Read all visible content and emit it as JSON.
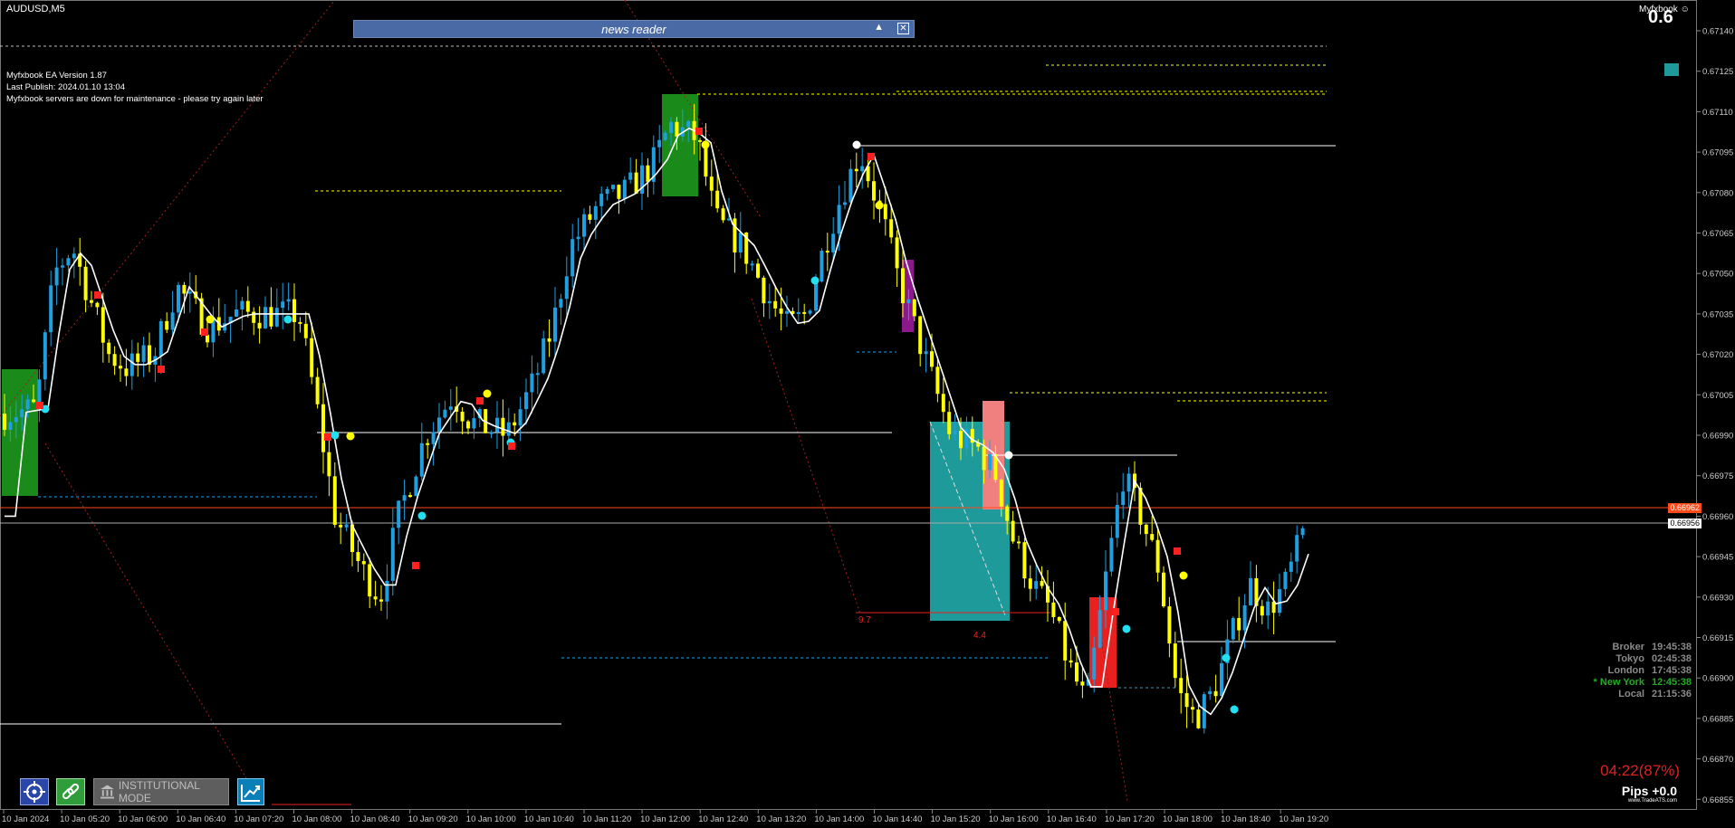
{
  "symbol": "AUDUSD,M5",
  "ea_info": [
    "Myfxbook EA Version 1.87",
    "Last Publish: 2024.01.10 13:04",
    "Myfxbook servers are down for maintenance - please try again later"
  ],
  "news_reader": {
    "title": "news reader",
    "collapse_glyph": "▲",
    "close_glyph": "✕"
  },
  "myfxbook": {
    "label": "Myfxbook ☺",
    "value": "0.6"
  },
  "price_axis": [
    "0.67140",
    "0.67125",
    "0.67110",
    "0.67095",
    "0.67080",
    "0.67065",
    "0.67050",
    "0.67035",
    "0.67020",
    "0.67005",
    "0.66990",
    "0.66975",
    "0.66960",
    "0.66945",
    "0.66930",
    "0.66915",
    "0.66900",
    "0.66885",
    "0.66870",
    "0.66855"
  ],
  "price_marker_high": "0.66962",
  "price_marker_current": "0.66956",
  "time_axis": [
    "10 Jan 2024",
    "10 Jan 05:20",
    "10 Jan 06:00",
    "10 Jan 06:40",
    "10 Jan 07:20",
    "10 Jan 08:00",
    "10 Jan 08:40",
    "10 Jan 09:20",
    "10 Jan 10:00",
    "10 Jan 10:40",
    "10 Jan 11:20",
    "10 Jan 12:00",
    "10 Jan 12:40",
    "10 Jan 13:20",
    "10 Jan 14:00",
    "10 Jan 14:40",
    "10 Jan 15:20",
    "10 Jan 16:00",
    "10 Jan 16:40",
    "10 Jan 17:20",
    "10 Jan 18:00",
    "10 Jan 18:40",
    "10 Jan 19:20"
  ],
  "annotations": {
    "label_a": "9.7",
    "label_b": "4.4"
  },
  "clocks": [
    {
      "name": "Broker",
      "time": "19:45:38",
      "color": "#8a8a8a"
    },
    {
      "name": "Tokyo",
      "time": "02:45:38",
      "color": "#8a8a8a"
    },
    {
      "name": "London",
      "time": "17:45:38",
      "color": "#8a8a8a"
    },
    {
      "name": "* New York",
      "time": "12:45:38",
      "color": "#22aa22"
    },
    {
      "name": "Local",
      "time": "21:15:36",
      "color": "#8a8a8a"
    }
  ],
  "countdown": "04:22(87%)",
  "pips": "Pips +0.0",
  "tradeats": "www.TradeATS.com",
  "toolbar": {
    "institutional_label": "INSTITUTIONAL MODE"
  },
  "colors": {
    "bull": "#1e9fe0",
    "bear": "#ffff00",
    "line": "#ffffff",
    "red": "#ff2020",
    "teal": "#1e9a9a"
  },
  "icons": [
    "crosshair-target-icon",
    "link-icon",
    "bank-icon",
    "chart-arrow-icon"
  ]
}
